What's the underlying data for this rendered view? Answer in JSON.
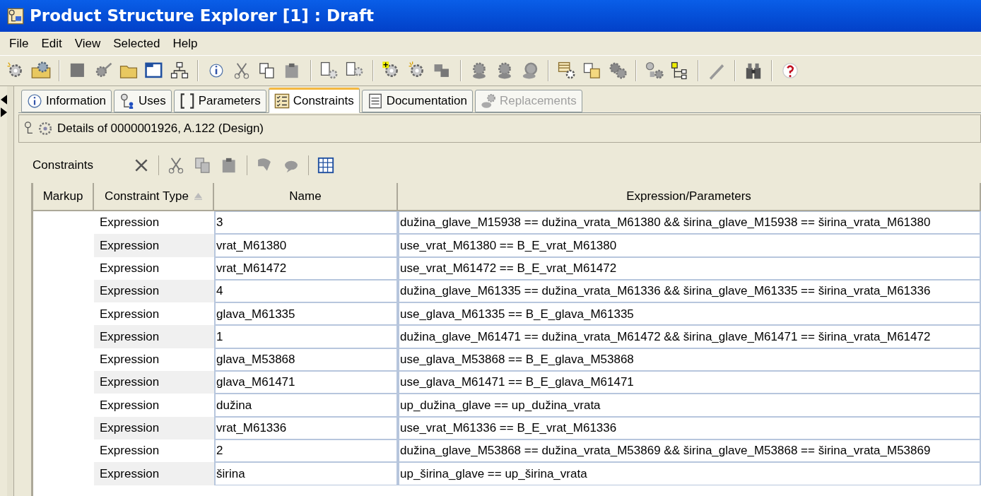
{
  "window": {
    "title": "Product Structure Explorer [1] : Draft"
  },
  "menu": [
    "File",
    "Edit",
    "View",
    "Selected",
    "Help"
  ],
  "tabs": [
    {
      "label": "Information",
      "selected": false,
      "disabled": false,
      "kind": "info"
    },
    {
      "label": "Uses",
      "selected": false,
      "disabled": false,
      "kind": "uses"
    },
    {
      "label": "Parameters",
      "selected": false,
      "disabled": false,
      "kind": "brackets"
    },
    {
      "label": "Constraints",
      "selected": true,
      "disabled": false,
      "kind": "list"
    },
    {
      "label": "Documentation",
      "selected": false,
      "disabled": false,
      "kind": "doc"
    },
    {
      "label": "Replacements",
      "selected": false,
      "disabled": true,
      "kind": "gear"
    }
  ],
  "details": "Details of 0000001926, A.122 (Design)",
  "constraints_label": "Constraints",
  "table": {
    "columns": [
      "Markup",
      "Constraint Type",
      "Name",
      "Expression/Parameters"
    ],
    "rows": [
      {
        "type": "Expression",
        "name": "3",
        "expression": "dužina_glave_M15938 == dužina_vrata_M61380 && širina_glave_M15938 == širina_vrata_M61380"
      },
      {
        "type": "Expression",
        "name": "vrat_M61380",
        "expression": "use_vrat_M61380 == B_E_vrat_M61380"
      },
      {
        "type": "Expression",
        "name": "vrat_M61472",
        "expression": "use_vrat_M61472 == B_E_vrat_M61472"
      },
      {
        "type": "Expression",
        "name": "4",
        "expression": "dužina_glave_M61335 == dužina_vrata_M61336 && širina_glave_M61335 == širina_vrata_M61336"
      },
      {
        "type": "Expression",
        "name": "glava_M61335",
        "expression": "use_glava_M61335 == B_E_glava_M61335"
      },
      {
        "type": "Expression",
        "name": "1",
        "expression": "dužina_glave_M61471 == dužina_vrata_M61472 && širina_glave_M61471 == širina_vrata_M61472"
      },
      {
        "type": "Expression",
        "name": "glava_M53868",
        "expression": "use_glava_M53868 == B_E_glava_M53868"
      },
      {
        "type": "Expression",
        "name": "glava_M61471",
        "expression": "use_glava_M61471 == B_E_glava_M61471"
      },
      {
        "type": "Expression",
        "name": "dužina",
        "expression": "up_dužina_glave == up_dužina_vrata"
      },
      {
        "type": "Expression",
        "name": "vrat_M61336",
        "expression": "use_vrat_M61336 == B_E_vrat_M61336"
      },
      {
        "type": "Expression",
        "name": "2",
        "expression": "dužina_glave_M53868 == dužina_vrata_M53869 && širina_glave_M53868 == širina_vrata_M53869"
      },
      {
        "type": "Expression",
        "name": "širina",
        "expression": "up_širina_glave == up_širina_vrata"
      }
    ]
  }
}
